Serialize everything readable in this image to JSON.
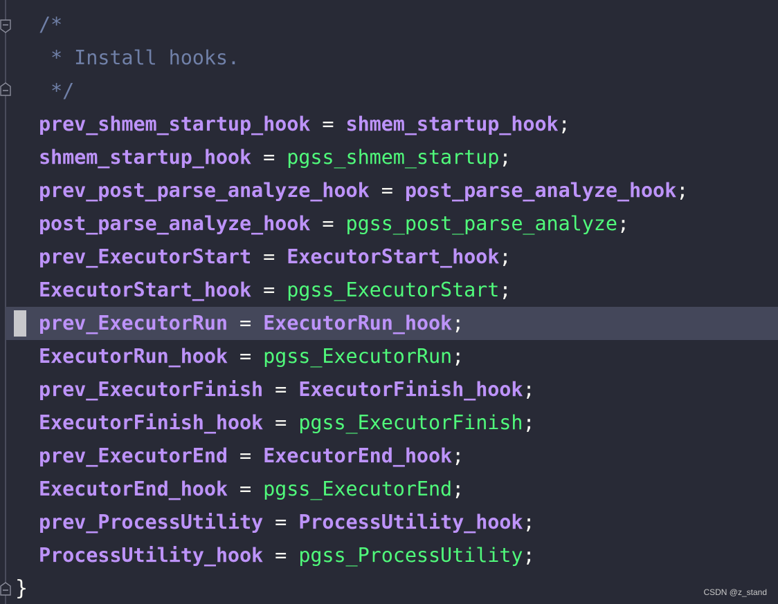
{
  "editor": {
    "comment_lines": [
      "/*",
      " * Install hooks.",
      " */"
    ],
    "assignments": [
      {
        "lhs": "prev_shmem_startup_hook",
        "rhs": "shmem_startup_hook",
        "rhs_kind": "hook"
      },
      {
        "lhs": "shmem_startup_hook",
        "rhs": "pgss_shmem_startup",
        "rhs_kind": "func"
      },
      {
        "lhs": "prev_post_parse_analyze_hook",
        "rhs": "post_parse_analyze_hook",
        "rhs_kind": "hook"
      },
      {
        "lhs": "post_parse_analyze_hook",
        "rhs": "pgss_post_parse_analyze",
        "rhs_kind": "func"
      },
      {
        "lhs": "prev_ExecutorStart",
        "rhs": "ExecutorStart_hook",
        "rhs_kind": "hook"
      },
      {
        "lhs": "ExecutorStart_hook",
        "rhs": "pgss_ExecutorStart",
        "rhs_kind": "func"
      },
      {
        "lhs": "prev_ExecutorRun",
        "rhs": "ExecutorRun_hook",
        "rhs_kind": "hook"
      },
      {
        "lhs": "ExecutorRun_hook",
        "rhs": "pgss_ExecutorRun",
        "rhs_kind": "func"
      },
      {
        "lhs": "prev_ExecutorFinish",
        "rhs": "ExecutorFinish_hook",
        "rhs_kind": "hook"
      },
      {
        "lhs": "ExecutorFinish_hook",
        "rhs": "pgss_ExecutorFinish",
        "rhs_kind": "func"
      },
      {
        "lhs": "prev_ExecutorEnd",
        "rhs": "ExecutorEnd_hook",
        "rhs_kind": "hook"
      },
      {
        "lhs": "ExecutorEnd_hook",
        "rhs": "pgss_ExecutorEnd",
        "rhs_kind": "func"
      },
      {
        "lhs": "prev_ProcessUtility",
        "rhs": "ProcessUtility_hook",
        "rhs_kind": "hook"
      },
      {
        "lhs": "ProcessUtility_hook",
        "rhs": "pgss_ProcessUtility",
        "rhs_kind": "func"
      }
    ],
    "operator": " = ",
    "terminator": ";",
    "closing_brace": "}",
    "current_line_index": 6
  },
  "watermark": "CSDN @z_stand",
  "colors": {
    "background": "#282a36",
    "comment": "#7080a8",
    "identifier": "#bd93f9",
    "function": "#50fa7b",
    "operator": "#f8f8f2",
    "current_line": "#44475a"
  },
  "icons": {
    "fold_open": "fold-minus-icon",
    "fold_end": "fold-end-icon"
  }
}
